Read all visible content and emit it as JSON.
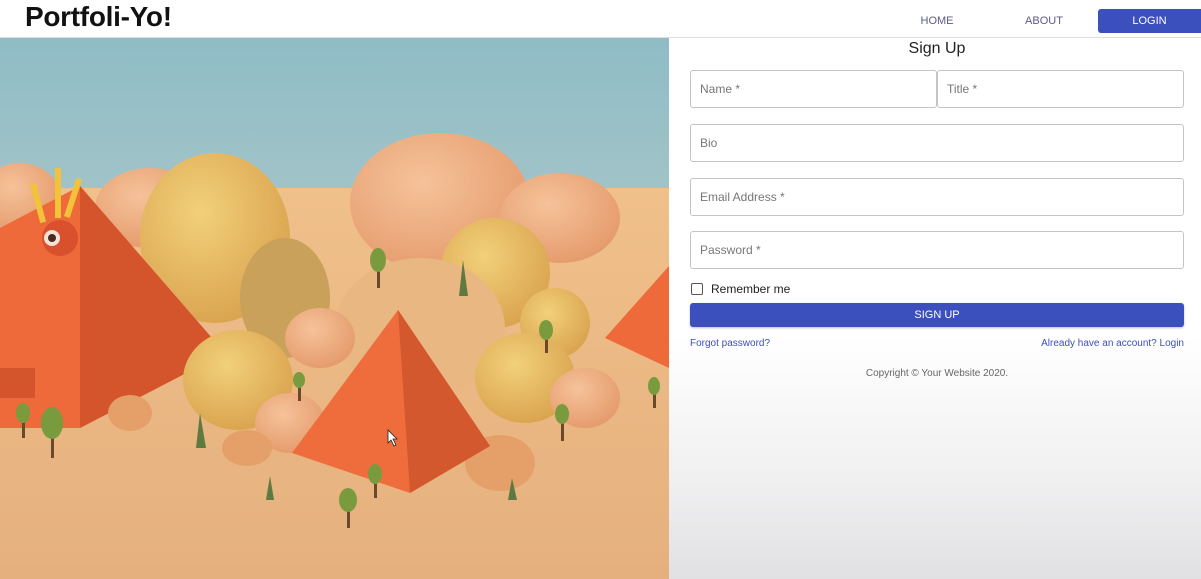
{
  "navbar": {
    "brand": "Portfoli-Yo!",
    "home_label": "HOME",
    "about_label": "ABOUT",
    "login_label": "LOGIN"
  },
  "hero": {
    "colors": {
      "sky": "#92bec6",
      "sand": "#e8b27a",
      "pyramid": "#ee6a3a",
      "dome": "#e9c06a",
      "tree": "#7a9a3e"
    }
  },
  "form": {
    "title": "Sign Up",
    "name_placeholder": "Name *",
    "title_placeholder": "Title *",
    "bio_placeholder": "Bio",
    "email_placeholder": "Email Address *",
    "password_placeholder": "Password *",
    "remember_label": "Remember me",
    "signup_label": "SIGN UP",
    "forgot_label": "Forgot password?",
    "login_link_label": "Already have an account? Login",
    "copyright": "Copyright © Your Website 2020."
  },
  "colors": {
    "accent": "#3b4fbd"
  }
}
